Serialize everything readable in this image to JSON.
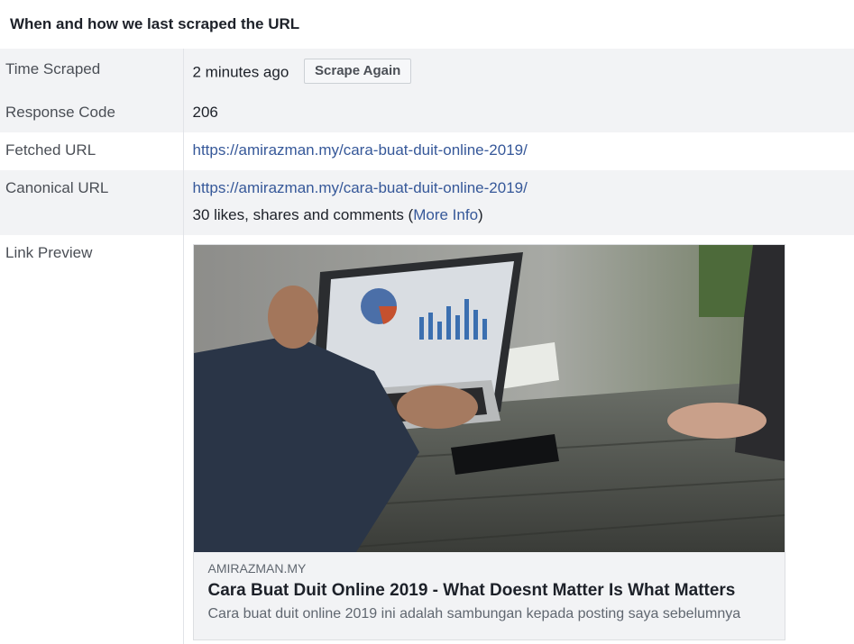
{
  "section_title": "When and how we last scraped the URL",
  "rows": {
    "time_scraped": {
      "label": "Time Scraped",
      "value": "2 minutes ago",
      "button": "Scrape Again"
    },
    "response_code": {
      "label": "Response Code",
      "value": "206"
    },
    "fetched_url": {
      "label": "Fetched URL",
      "value": "https://amirazman.my/cara-buat-duit-online-2019/"
    },
    "canonical_url": {
      "label": "Canonical URL",
      "value": "https://amirazman.my/cara-buat-duit-online-2019/",
      "engagement_prefix": "30 likes, shares and comments (",
      "more_info": "More Info",
      "engagement_suffix": ")"
    },
    "link_preview": {
      "label": "Link Preview",
      "image_icon": "laptop-business-photo",
      "domain": "AMIRAZMAN.MY",
      "headline": "Cara Buat Duit Online 2019 - What Doesnt Matter Is What Matters",
      "description": "Cara buat duit online 2019 ini adalah sambungan kepada posting saya sebelumnya"
    }
  },
  "colors": {
    "link": "#365899",
    "row_shade": "#f2f3f5",
    "text": "#1d2129",
    "label": "#4b4f56"
  }
}
